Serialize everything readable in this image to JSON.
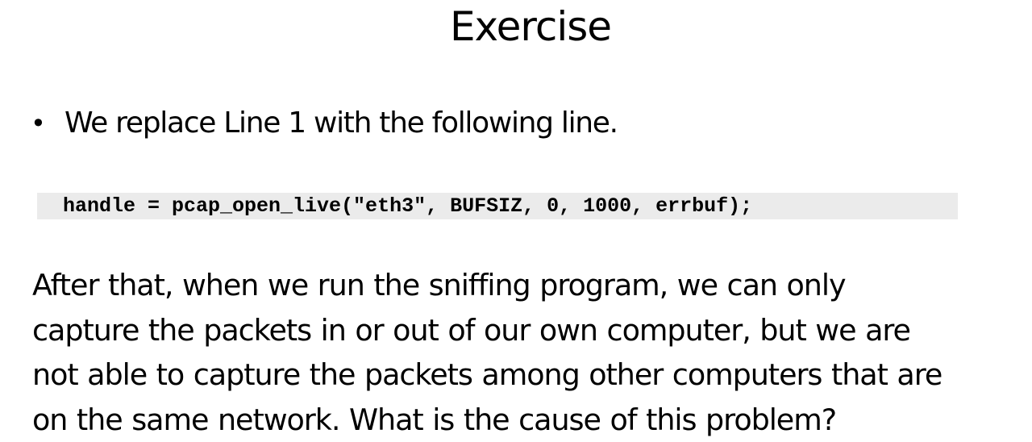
{
  "slide": {
    "title": "Exercise",
    "bullet_symbol": "•",
    "bullet_text": "We replace Line 1 with the following line.",
    "code_line": "handle = pcap_open_live(\"eth3\", BUFSIZ, 0, 1000, errbuf);",
    "paragraph_lines": [
      "After that, when we run the sniffing program, we can only",
      "capture the packets in or out of our own computer, but we are",
      "not able to capture the packets among other computers that are",
      "on the same network. What is the cause of this problem?"
    ]
  }
}
